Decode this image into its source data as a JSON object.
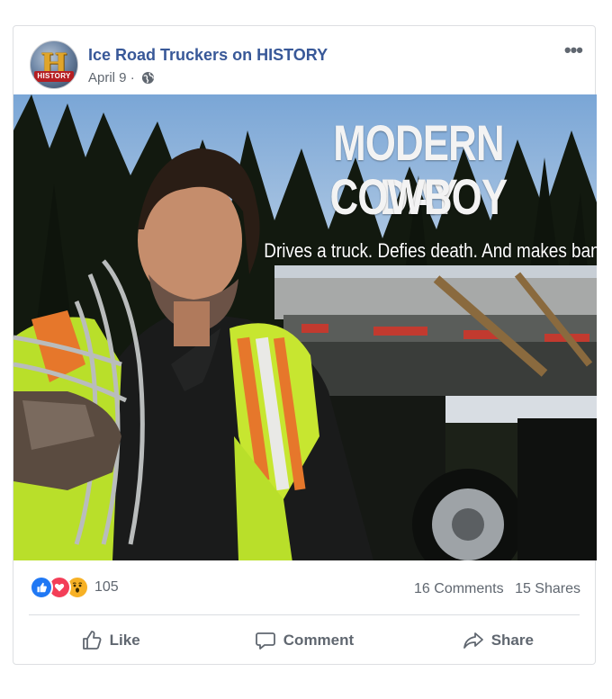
{
  "post": {
    "page_name": "Ice Road Truckers on HISTORY",
    "date": "April 9",
    "separator": "·",
    "avatar_text": "HISTORY",
    "avatar_letter": "H",
    "more_icon": "•••"
  },
  "image": {
    "headline_line1": "MODERN DAY",
    "headline_line2": "COWBOY",
    "tagline": "Drives a truck. Defies death. And makes bank."
  },
  "stats": {
    "reaction_count": "105",
    "comments": "16 Comments",
    "shares": "15 Shares"
  },
  "actions": {
    "like": "Like",
    "comment": "Comment",
    "share": "Share"
  },
  "colors": {
    "link_blue": "#385898",
    "like_blue": "#2078f4",
    "love_red": "#f33e58",
    "wow_yellow": "#f7b125"
  }
}
